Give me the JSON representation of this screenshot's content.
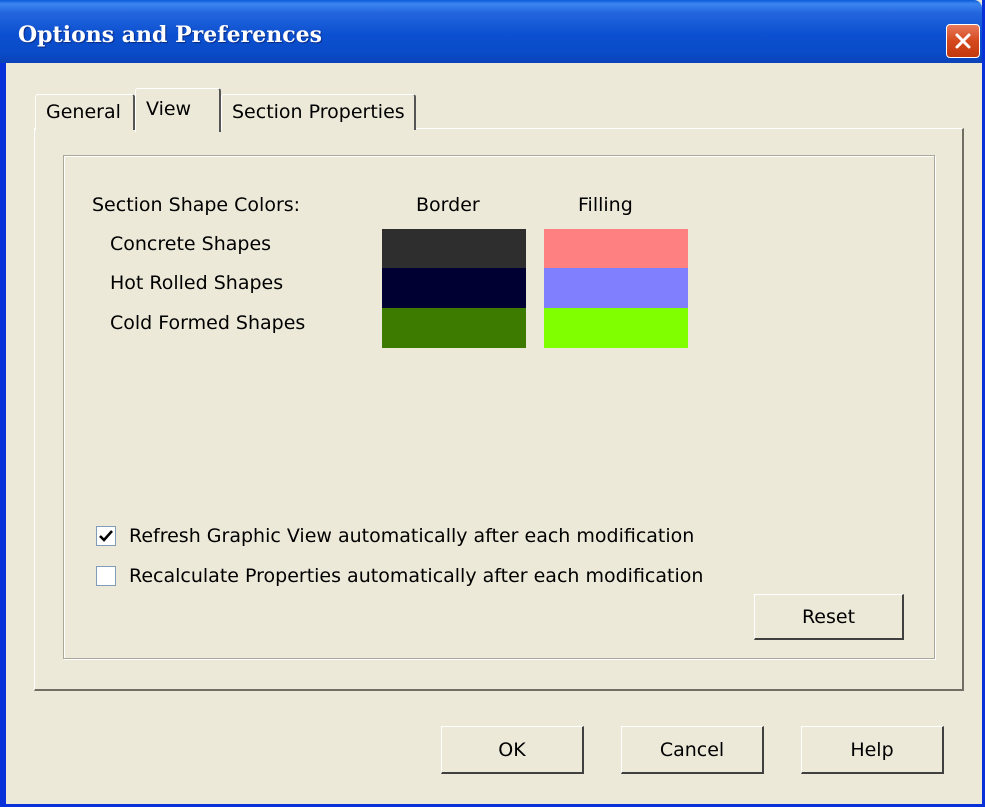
{
  "window": {
    "title": "Options and Preferences"
  },
  "tabs": [
    {
      "label": "General"
    },
    {
      "label": "View",
      "selected": true
    },
    {
      "label": "Section Properties"
    }
  ],
  "colors": {
    "header": "Section Shape Colors:",
    "border_header": "Border",
    "filling_header": "Filling",
    "rows": [
      {
        "label": "Concrete Shapes",
        "border": "#2e2e2e",
        "filling": "#ff8080"
      },
      {
        "label": "Hot Rolled Shapes",
        "border": "#000033",
        "filling": "#8080ff"
      },
      {
        "label": "Cold Formed Shapes",
        "border": "#3d7a00",
        "filling": "#80ff00"
      }
    ]
  },
  "options": {
    "refresh": {
      "label": "Refresh Graphic View automatically after each modification",
      "checked": true
    },
    "recalc": {
      "label": "Recalculate Properties automatically after each modification",
      "checked": false
    }
  },
  "buttons": {
    "reset": "Reset",
    "ok": "OK",
    "cancel": "Cancel",
    "help": "Help"
  }
}
